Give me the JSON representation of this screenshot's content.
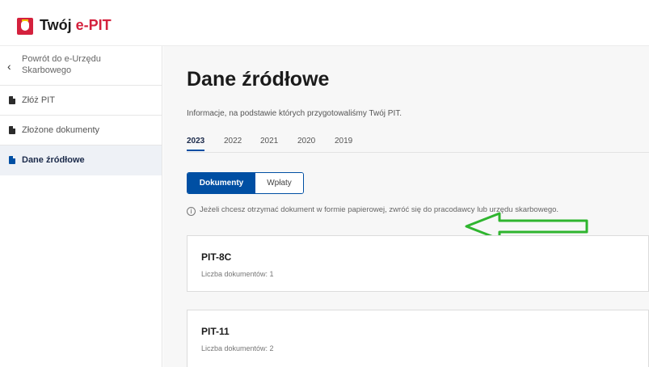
{
  "header": {
    "logo_text_main": "Twój ",
    "logo_text_accent": "e-PIT"
  },
  "sidebar": {
    "items": [
      {
        "label": "Powrót do e-Urzędu Skarbowego",
        "icon": "chevron-left-icon"
      },
      {
        "label": "Złóż PIT",
        "icon": "document-icon"
      },
      {
        "label": "Złożone dokumenty",
        "icon": "document-icon"
      },
      {
        "label": "Dane źródłowe",
        "icon": "document-icon",
        "active": true
      }
    ]
  },
  "main": {
    "title": "Dane źródłowe",
    "description": "Informacje, na podstawie których przygotowaliśmy Twój PIT.",
    "tabs": [
      {
        "label": "2023",
        "active": true
      },
      {
        "label": "2022"
      },
      {
        "label": "2021"
      },
      {
        "label": "2020"
      },
      {
        "label": "2019"
      }
    ],
    "segment": {
      "documents_label": "Dokumenty",
      "payments_label": "Wpłaty",
      "selected": "Dokumenty"
    },
    "info_icon": "i",
    "info_text": "Jeżeli chcesz otrzymać dokument w formie papierowej, zwróć się do pracodawcy lub urzędu skarbowego.",
    "cards": [
      {
        "title": "PIT-8C",
        "subtitle": "Liczba dokumentów: 1"
      },
      {
        "title": "PIT-11",
        "subtitle": "Liczba dokumentów: 2"
      }
    ]
  },
  "colors": {
    "brand_red": "#d4213d",
    "primary_blue": "#004fa3",
    "annotation_arrow": "#2fb52f"
  }
}
